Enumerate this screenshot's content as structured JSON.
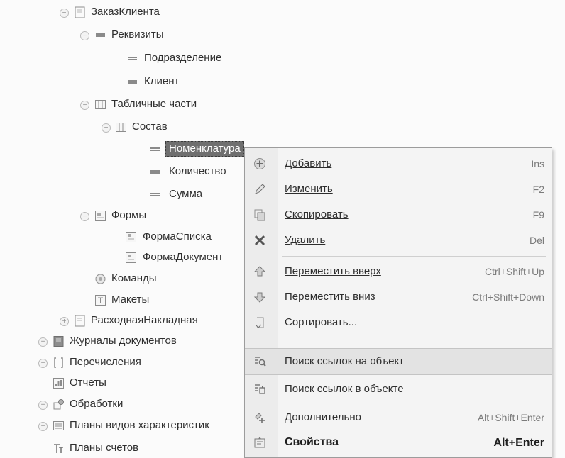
{
  "tree": {
    "zakaz": "ЗаказКлиента",
    "rekvizity": "Реквизиты",
    "podrazdelenie": "Подразделение",
    "klient": "Клиент",
    "tablichnye": "Табличные части",
    "sostav": "Состав",
    "nomenklatura": "Номенклатура",
    "kolichestvo": "Количество",
    "summa": "Сумма",
    "formy": "Формы",
    "forma_spiska": "ФормаСписка",
    "forma_dokumenta": "ФормаДокумент",
    "komandy": "Команды",
    "makety": "Макеты",
    "raskhodnaya": "РасходнаяНакладная",
    "zhurnaly": "Журналы документов",
    "perechisleniya": "Перечисления",
    "otchety": "Отчеты",
    "obrabotki": "Обработки",
    "plany_vidov": "Планы видов характеристик",
    "plany_schetov": "Планы счетов"
  },
  "menu": {
    "add": {
      "label": "Добавить",
      "key": "Ins"
    },
    "edit": {
      "label": "Изменить",
      "key": "F2"
    },
    "copy": {
      "label": "Скопировать",
      "key": "F9"
    },
    "delete": {
      "label": "Удалить",
      "key": "Del"
    },
    "move_up": {
      "label": "Переместить вверх",
      "key": "Ctrl+Shift+Up"
    },
    "move_down": {
      "label": "Переместить вниз",
      "key": "Ctrl+Shift+Down"
    },
    "sort": {
      "label": "Сортировать..."
    },
    "find_refs_to": {
      "label": "Поиск ссылок на объект"
    },
    "find_refs_in": {
      "label": "Поиск ссылок в объекте"
    },
    "more": {
      "label": "Дополнительно",
      "key": "Alt+Shift+Enter"
    },
    "props": {
      "label": "Свойства",
      "key": "Alt+Enter"
    }
  },
  "colors": {
    "selection": "#6f6f6f",
    "menu_bg": "#f4f4f4",
    "highlight": "#e3e3e3"
  }
}
